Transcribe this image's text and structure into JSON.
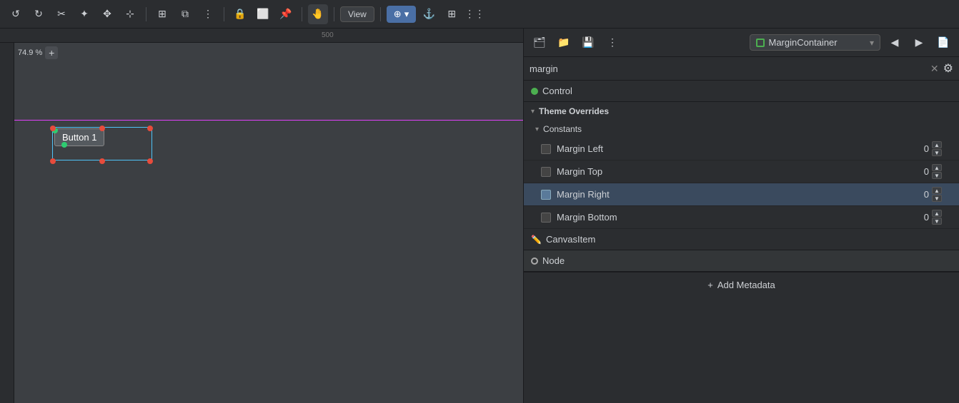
{
  "toolbar": {
    "buttons": [
      "↺",
      "↻",
      "✂",
      "✦",
      "✥",
      "☰",
      "⊹",
      "⧉",
      "⋮",
      "🔒",
      "⬜",
      "📌"
    ],
    "view_label": "View",
    "add_icon": "⊕",
    "anchor_icon": "⚓",
    "grid_icon": "⊞"
  },
  "canvas": {
    "zoom_label": "74.9 %",
    "zoom_add_label": "+",
    "ruler_500": "500",
    "guide_visible": true,
    "button_label": "Button 1"
  },
  "right_panel": {
    "topbar": {
      "node_name": "MarginContainer",
      "icons": [
        "🗂",
        "📁",
        "💾",
        "⋮",
        "◀",
        "▶",
        "⬆"
      ]
    },
    "search": {
      "placeholder": "margin",
      "value": "margin",
      "clear_label": "✕",
      "filter_label": "⚙"
    },
    "sections": {
      "control": {
        "label": "Control",
        "dot_color": "#4caf50"
      },
      "theme_overrides": {
        "label": "Theme Overrides",
        "expanded": true,
        "constants": {
          "label": "Constants",
          "expanded": true,
          "properties": [
            {
              "name": "Margin Left",
              "value": "0",
              "checked": false
            },
            {
              "name": "Margin Top",
              "value": "0",
              "checked": false
            },
            {
              "name": "Margin Right",
              "value": "0",
              "checked": false,
              "highlighted": true
            },
            {
              "name": "Margin Bottom",
              "value": "0",
              "checked": false
            }
          ]
        }
      },
      "canvas_item": {
        "label": "CanvasItem"
      },
      "node": {
        "label": "Node"
      },
      "add_metadata": {
        "label": "Add Metadata",
        "icon": "+"
      }
    }
  }
}
